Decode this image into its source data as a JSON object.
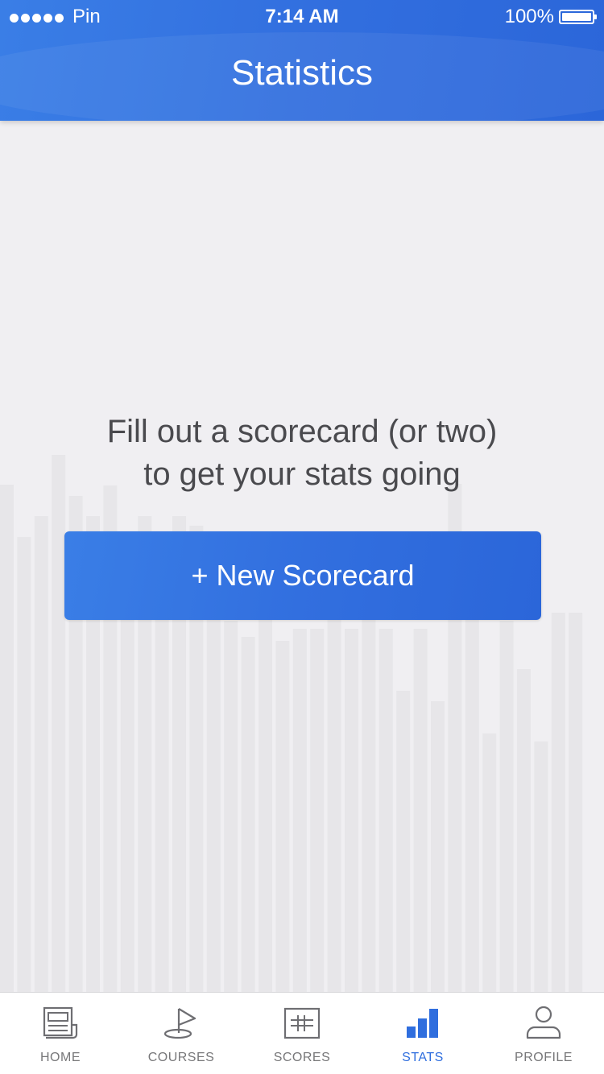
{
  "status_bar": {
    "carrier": "Pin",
    "time": "7:14 AM",
    "battery_percent": "100%"
  },
  "header": {
    "title": "Statistics"
  },
  "empty_state": {
    "line1": "Fill out a scorecard (or two)",
    "line2": "to get your stats going",
    "button_label": "+ New Scorecard"
  },
  "tabbar": {
    "tabs": [
      {
        "label": "HOME",
        "icon": "newspaper-icon",
        "active": false
      },
      {
        "label": "COURSES",
        "icon": "golf-flag-icon",
        "active": false
      },
      {
        "label": "SCORES",
        "icon": "scorecard-grid-icon",
        "active": false
      },
      {
        "label": "STATS",
        "icon": "bar-chart-icon",
        "active": true
      },
      {
        "label": "PROFILE",
        "icon": "person-icon",
        "active": false
      }
    ]
  },
  "colors": {
    "accent": "#2f6ede",
    "background": "#f0eff2",
    "inactive_tab": "#777779"
  }
}
